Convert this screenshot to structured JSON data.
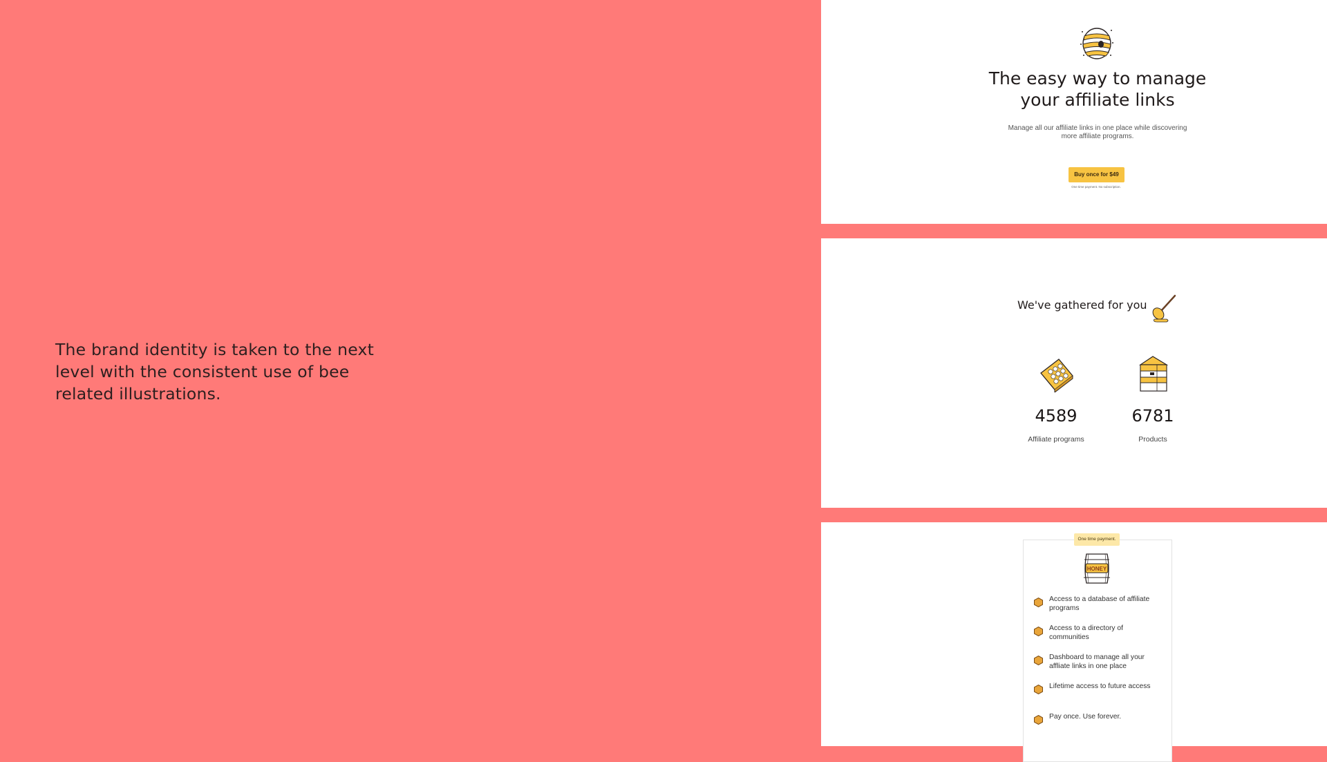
{
  "caption": "The brand identity is taken to the next level with the consistent use of bee related illustrations.",
  "hero": {
    "title_line1": "The easy way to manage",
    "title_line2": "your affiliate links",
    "subtitle": "Manage all our affiliate links in one place while discovering more affiliate programs.",
    "cta_label": "Buy once for $49",
    "cta_note": "One time payment. No subscription."
  },
  "gathered": {
    "heading": "We've gathered for you",
    "stats": [
      {
        "value": "4589",
        "label": "Affiliate programs",
        "icon": "honeycomb-icon"
      },
      {
        "value": "6781",
        "label": "Products",
        "icon": "beehive-box-icon"
      }
    ]
  },
  "pricing": {
    "badge": "One time payment.",
    "barrel_label": "HONEY",
    "features": [
      "Access to a database of affiliate programs",
      "Access to a directory of communities",
      "Dashboard to manage all your affliate links in one place",
      "Lifetime access to future access",
      "Pay once. Use forever."
    ]
  },
  "colors": {
    "background": "#ff7a78",
    "accent_yellow": "#f7c342",
    "panel": "#ffffff",
    "hex_bullet": "#e9a53a"
  }
}
